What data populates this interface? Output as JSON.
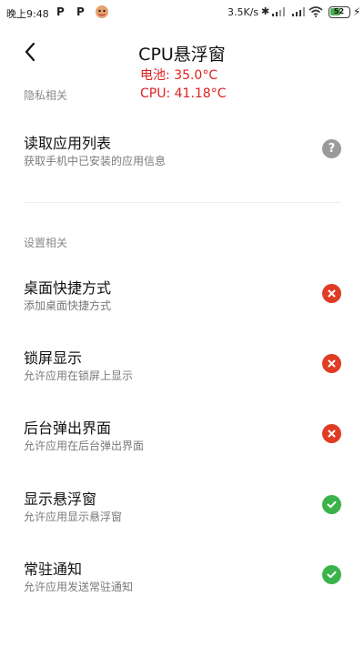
{
  "status_bar": {
    "time": "晚上9:48",
    "notif_p1": "P",
    "notif_p2": "P",
    "net_speed": "3.5K/s",
    "battery": "52"
  },
  "header": {
    "title": "CPU悬浮窗",
    "back_icon": "chevron-left-icon"
  },
  "overlay": {
    "battery_temp": "电池: 35.0°C",
    "cpu_temp": "CPU: 41.18°C"
  },
  "sections": {
    "privacy": {
      "header": "隐私相关",
      "items": [
        {
          "title": "读取应用列表",
          "desc": "获取手机中已安装的应用信息",
          "status": "unknown",
          "icon": "question-icon",
          "glyph": "?"
        }
      ]
    },
    "settings": {
      "header": "设置相关",
      "items": [
        {
          "title": "桌面快捷方式",
          "desc": "添加桌面快捷方式",
          "status": "denied",
          "icon": "x-circle-icon"
        },
        {
          "title": "锁屏显示",
          "desc": "允许应用在锁屏上显示",
          "status": "denied",
          "icon": "x-circle-icon"
        },
        {
          "title": "后台弹出界面",
          "desc": "允许应用在后台弹出界面",
          "status": "denied",
          "icon": "x-circle-icon"
        },
        {
          "title": "显示悬浮窗",
          "desc": "允许应用显示悬浮窗",
          "status": "granted",
          "icon": "check-circle-icon"
        },
        {
          "title": "常驻通知",
          "desc": "允许应用发送常驻通知",
          "status": "granted",
          "icon": "check-circle-icon"
        }
      ]
    }
  },
  "colors": {
    "denied": "#e03b24",
    "granted": "#3bb34a",
    "unknown": "#9a9a9a",
    "overlay_text": "#e02020"
  }
}
